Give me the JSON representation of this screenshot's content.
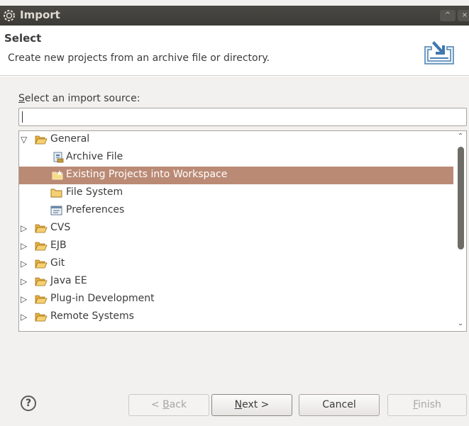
{
  "window": {
    "title": "Import",
    "controls": [
      "^",
      "×"
    ]
  },
  "header": {
    "title": "Select",
    "description": "Create new projects from an archive file or directory."
  },
  "source": {
    "label_prefix": "S",
    "label_rest": "elect an import source:",
    "filter_value": ""
  },
  "tree": {
    "items": [
      {
        "label": "General",
        "expander": "▽",
        "icon": "open-folder-icon"
      },
      {
        "label": "Archive File",
        "icon": "archive-file-icon"
      },
      {
        "label": "Existing Projects into Workspace",
        "icon": "existing-project-icon",
        "selected": true
      },
      {
        "label": "File System",
        "icon": "folder-icon"
      },
      {
        "label": "Preferences",
        "icon": "preferences-icon"
      },
      {
        "label": "CVS",
        "expander": "▷",
        "icon": "open-folder-icon"
      },
      {
        "label": "EJB",
        "expander": "▷",
        "icon": "open-folder-icon"
      },
      {
        "label": "Git",
        "expander": "▷",
        "icon": "open-folder-icon"
      },
      {
        "label": "Java EE",
        "expander": "▷",
        "icon": "open-folder-icon"
      },
      {
        "label": "Plug-in Development",
        "expander": "▷",
        "icon": "open-folder-icon"
      },
      {
        "label": "Remote Systems",
        "expander": "▷",
        "icon": "open-folder-icon"
      }
    ]
  },
  "buttons": {
    "help": "?",
    "back_pre": "< ",
    "back_mn": "B",
    "back_rest": "ack",
    "next_mn": "N",
    "next_rest": "ext >",
    "cancel": "Cancel",
    "finish_mn": "F",
    "finish_rest": "inish"
  },
  "colors": {
    "selection": "#bb8a75",
    "titlebar": "#3c3b37",
    "folder": "#f0c050"
  }
}
